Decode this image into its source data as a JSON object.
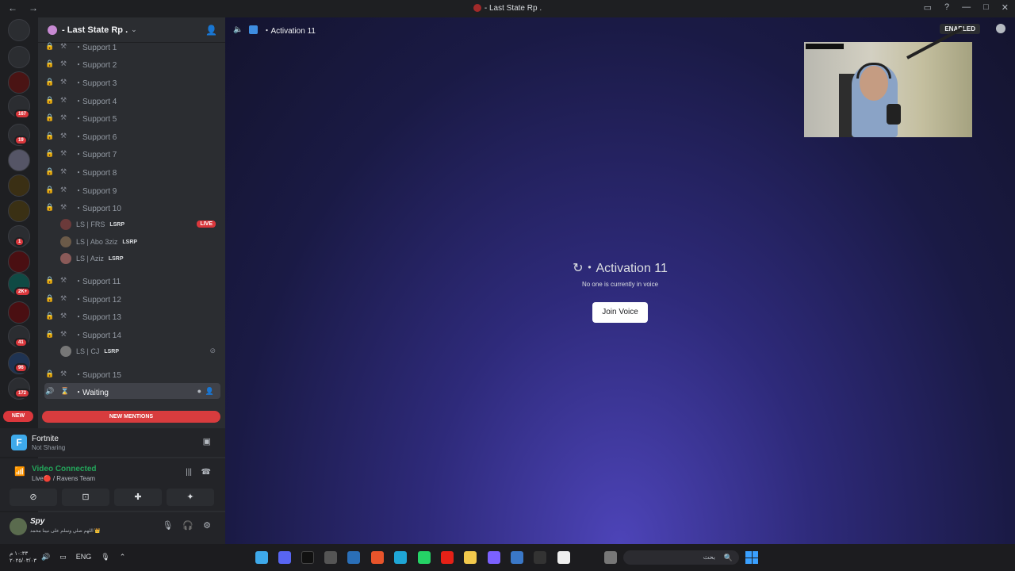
{
  "window": {
    "title": "- Last State Rp ."
  },
  "guild_badges": [
    "167",
    "19",
    "1",
    "2K+",
    "41",
    "96",
    "172"
  ],
  "sidebar": {
    "server_name": "- Last State Rp .",
    "channels_top": [
      {
        "label": "・Support 1"
      },
      {
        "label": "・Support 2"
      },
      {
        "label": "・Support 3"
      },
      {
        "label": "・Support 4"
      },
      {
        "label": "・Support 5"
      },
      {
        "label": "・Support 6"
      },
      {
        "label": "・Support 7"
      },
      {
        "label": "・Support 8"
      },
      {
        "label": "・Support 9"
      },
      {
        "label": "・Support 10"
      }
    ],
    "members_support10": [
      {
        "name": "LS | FRS",
        "tag": "LSRP",
        "live": "LIVE"
      },
      {
        "name": "LS | Abo 3ziz",
        "tag": "LSRP"
      },
      {
        "name": "LS | Aziz",
        "tag": "LSRP"
      }
    ],
    "channels_mid": [
      {
        "label": "・Support 11"
      },
      {
        "label": "・Support 12"
      },
      {
        "label": "・Support 13"
      },
      {
        "label": "・Support 14"
      }
    ],
    "members_support14": [
      {
        "name": "LS | CJ",
        "tag": "LSRP"
      }
    ],
    "channels_bottom": [
      {
        "label": "・Support 15"
      }
    ],
    "active_channel": "・Waiting",
    "new_mentions": "NEW MENTIONS",
    "new_pill": "NEW"
  },
  "activity": {
    "game": "Fortnite",
    "status": "Not Sharing"
  },
  "voice": {
    "status": "Video Connected",
    "channel": "Live🔴 / Ravens Team"
  },
  "user": {
    "name": "Spy",
    "status": "اللهم صلي وسلم على نبينا محمد 👑"
  },
  "main": {
    "channel": "・Activation 11",
    "enabled": "ENABLED",
    "heading": "・Activation 11",
    "subtext": "No one is currently in voice",
    "join_button": "Join Voice"
  },
  "taskbar": {
    "time": "١٠:٣٣ م",
    "date": "٢٠٢٥/٠٣/٠٣",
    "lang": "ENG",
    "search_placeholder": "بحث"
  },
  "colors": {
    "accent": "#5865f2",
    "danger": "#da373c",
    "success": "#23a55a"
  }
}
